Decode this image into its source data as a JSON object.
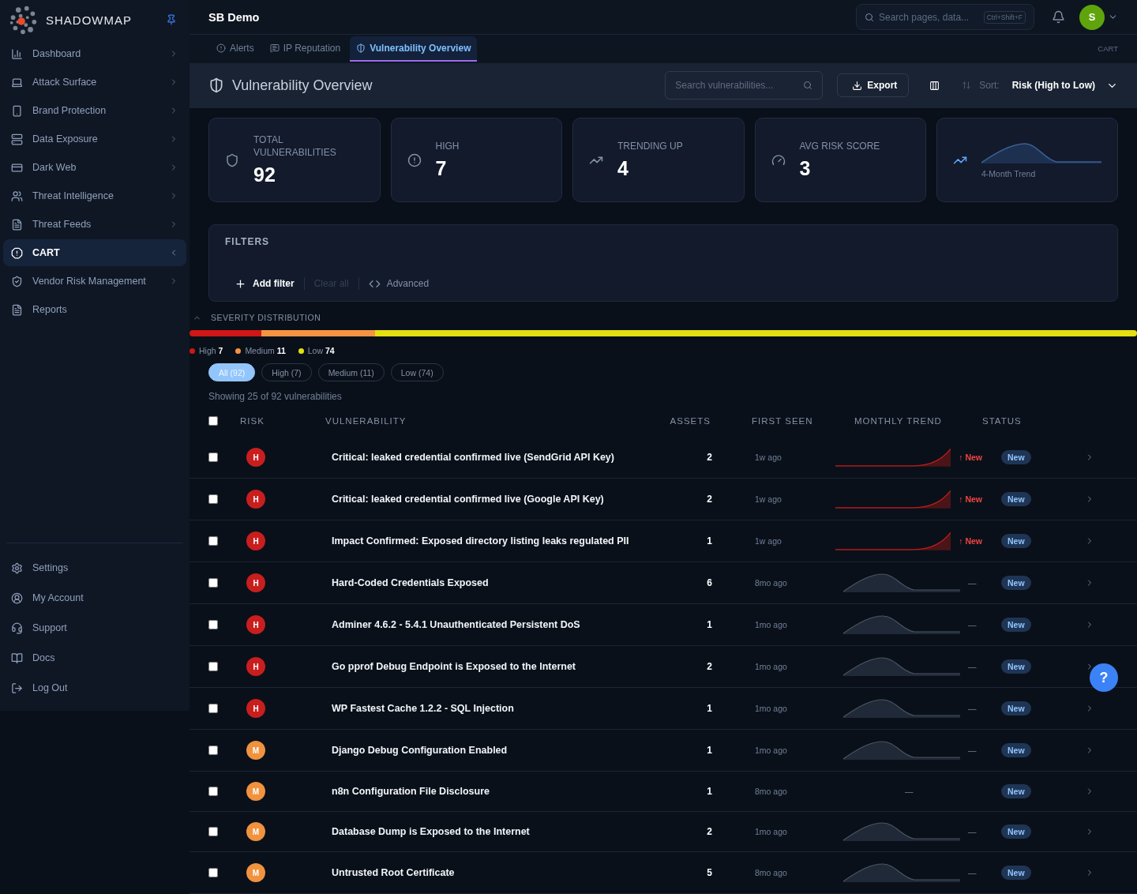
{
  "brand": {
    "name": "SHADOWMAP"
  },
  "sidebar": {
    "items": [
      {
        "label": "Dashboard",
        "kind": "group",
        "expanded": false,
        "selected": false
      },
      {
        "label": "Attack Surface",
        "kind": "group",
        "expanded": false,
        "selected": false
      },
      {
        "label": "Brand Protection",
        "kind": "group",
        "expanded": false,
        "selected": false
      },
      {
        "label": "Data Exposure",
        "kind": "group",
        "expanded": false,
        "selected": false
      },
      {
        "label": "Dark Web",
        "kind": "group",
        "expanded": false,
        "selected": false
      },
      {
        "label": "Threat Intelligence",
        "kind": "group",
        "expanded": false,
        "selected": false
      },
      {
        "label": "Threat Feeds",
        "kind": "group",
        "expanded": false,
        "selected": false
      },
      {
        "label": "CART",
        "kind": "group",
        "expanded": true,
        "selected": true
      },
      {
        "label": "Vendor Risk Management",
        "kind": "group",
        "expanded": false,
        "selected": false
      },
      {
        "label": "Reports",
        "kind": "link",
        "selected": false
      }
    ],
    "bottom_items": [
      {
        "label": "Settings"
      },
      {
        "label": "My Account"
      },
      {
        "label": "Support"
      },
      {
        "label": "Docs"
      },
      {
        "label": "Log Out"
      }
    ]
  },
  "header": {
    "title": "SB Demo",
    "search": {
      "placeholder": "Search pages, data...",
      "shortcut": "Ctrl+Shift+F"
    },
    "avatar": "S"
  },
  "tabs": [
    {
      "label": "Alerts",
      "selected": false
    },
    {
      "label": "IP Reputation",
      "selected": false
    },
    {
      "label": "Vulnerability Overview",
      "selected": true
    }
  ],
  "breadcrumb": "CART",
  "page": {
    "title": "Vulnerability Overview",
    "search": {
      "placeholder": "Search vulnerabilities..."
    },
    "export": "Export",
    "sort_label": "Sort:",
    "sort_value": "Risk (High to Low)"
  },
  "stats": [
    {
      "label": "TOTAL VULNERABILITIES",
      "value": "92"
    },
    {
      "label": "HIGH",
      "value": "7"
    },
    {
      "label": "TRENDING UP",
      "value": "4"
    },
    {
      "label": "AVG RISK SCORE",
      "value": "3"
    }
  ],
  "trend_card": {
    "label": "4-Month Trend"
  },
  "filters": {
    "title": "FILTERS",
    "add": "Add filter",
    "clear": "Clear all",
    "clear_disabled": true,
    "advanced": "Advanced"
  },
  "severity": {
    "title": "SEVERITY DISTRIBUTION",
    "expanded": true,
    "segments": [
      {
        "label": "High",
        "count": "7",
        "color": "#d01616"
      },
      {
        "label": "Medium",
        "count": "11",
        "color": "#f59342"
      },
      {
        "label": "Low",
        "count": "74",
        "color": "#e5e010"
      }
    ],
    "chips": [
      {
        "label": "All (92)",
        "selected": true
      },
      {
        "label": "High (7)",
        "selected": false
      },
      {
        "label": "Medium (11)",
        "selected": false
      },
      {
        "label": "Low (74)",
        "selected": false
      }
    ],
    "showing": "Showing 25 of 92 vulnerabilities"
  },
  "table": {
    "columns": [
      "RISK",
      "VULNERABILITY",
      "ASSETS",
      "FIRST SEEN",
      "MONTHLY TREND",
      "STATUS"
    ],
    "all_checked": false,
    "rows": [
      {
        "risk": "H",
        "kind": "high",
        "name": "Critical: leaked credential confirmed live (SendGrid API Key)",
        "assets": "2",
        "first_seen": "1w ago",
        "trend": {
          "kind": "spike",
          "change": "↑ New"
        },
        "status": "New",
        "checked": false
      },
      {
        "risk": "H",
        "kind": "high",
        "name": "Critical: leaked credential confirmed live (Google API Key)",
        "assets": "2",
        "first_seen": "1w ago",
        "trend": {
          "kind": "spike",
          "change": "↑ New"
        },
        "status": "New",
        "checked": false
      },
      {
        "risk": "H",
        "kind": "high",
        "name": "Impact Confirmed: Exposed directory listing leaks regulated PII",
        "assets": "1",
        "first_seen": "1w ago",
        "trend": {
          "kind": "spike",
          "change": "↑ New"
        },
        "status": "New",
        "checked": false
      },
      {
        "risk": "H",
        "kind": "high",
        "name": "Hard-Coded Credentials Exposed",
        "assets": "6",
        "first_seen": "8mo ago",
        "trend": {
          "kind": "hump",
          "change": "—"
        },
        "status": "New",
        "checked": false
      },
      {
        "risk": "H",
        "kind": "high",
        "name": "Adminer 4.6.2 - 5.4.1 Unauthenticated Persistent DoS",
        "assets": "1",
        "first_seen": "1mo ago",
        "trend": {
          "kind": "hump",
          "change": "—"
        },
        "status": "New",
        "checked": false
      },
      {
        "risk": "H",
        "kind": "high",
        "name": "Go pprof Debug Endpoint is Exposed to the Internet",
        "assets": "2",
        "first_seen": "1mo ago",
        "trend": {
          "kind": "hump",
          "change": "—"
        },
        "status": "New",
        "checked": false
      },
      {
        "risk": "H",
        "kind": "high",
        "name": "WP Fastest Cache 1.2.2 - SQL Injection",
        "assets": "1",
        "first_seen": "1mo ago",
        "trend": {
          "kind": "hump",
          "change": "—"
        },
        "status": "New",
        "checked": false
      },
      {
        "risk": "M",
        "kind": "medium",
        "name": "Django Debug Configuration Enabled",
        "assets": "1",
        "first_seen": "1mo ago",
        "trend": {
          "kind": "hump",
          "change": "—"
        },
        "status": "New",
        "checked": false
      },
      {
        "risk": "M",
        "kind": "medium",
        "name": "n8n Configuration File Disclosure",
        "assets": "1",
        "first_seen": "8mo ago",
        "trend": {
          "kind": "none",
          "change": "—"
        },
        "status": "New",
        "checked": false
      },
      {
        "risk": "M",
        "kind": "medium",
        "name": "Database Dump is Exposed to the Internet",
        "assets": "2",
        "first_seen": "1mo ago",
        "trend": {
          "kind": "hump",
          "change": "—"
        },
        "status": "New",
        "checked": false
      },
      {
        "risk": "M",
        "kind": "medium",
        "name": "Untrusted Root Certificate",
        "assets": "5",
        "first_seen": "8mo ago",
        "trend": {
          "kind": "hump",
          "change": "—"
        },
        "status": "New",
        "checked": false
      }
    ]
  },
  "help_button": "?"
}
